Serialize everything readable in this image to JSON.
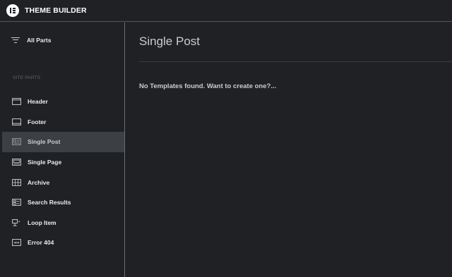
{
  "header": {
    "title": "THEME BUILDER",
    "logo_icon": "elementor-logo-icon"
  },
  "sidebar": {
    "all_parts_label": "All Parts",
    "section_label": "SITE PARTS",
    "items": [
      {
        "label": "Header",
        "icon": "header-icon",
        "active": false
      },
      {
        "label": "Footer",
        "icon": "footer-icon",
        "active": false
      },
      {
        "label": "Single Post",
        "icon": "single-post-icon",
        "active": true
      },
      {
        "label": "Single Page",
        "icon": "single-page-icon",
        "active": false
      },
      {
        "label": "Archive",
        "icon": "archive-icon",
        "active": false
      },
      {
        "label": "Search Results",
        "icon": "search-results-icon",
        "active": false
      },
      {
        "label": "Loop Item",
        "icon": "loop-item-icon",
        "active": false
      },
      {
        "label": "Error 404",
        "icon": "error-404-icon",
        "active": false
      }
    ]
  },
  "main": {
    "title": "Single Post",
    "empty_message": "No Templates found. Want to create one?..."
  },
  "colors": {
    "background": "#1f2124",
    "active_item": "#3c3f44",
    "text": "#d5d8dc"
  }
}
